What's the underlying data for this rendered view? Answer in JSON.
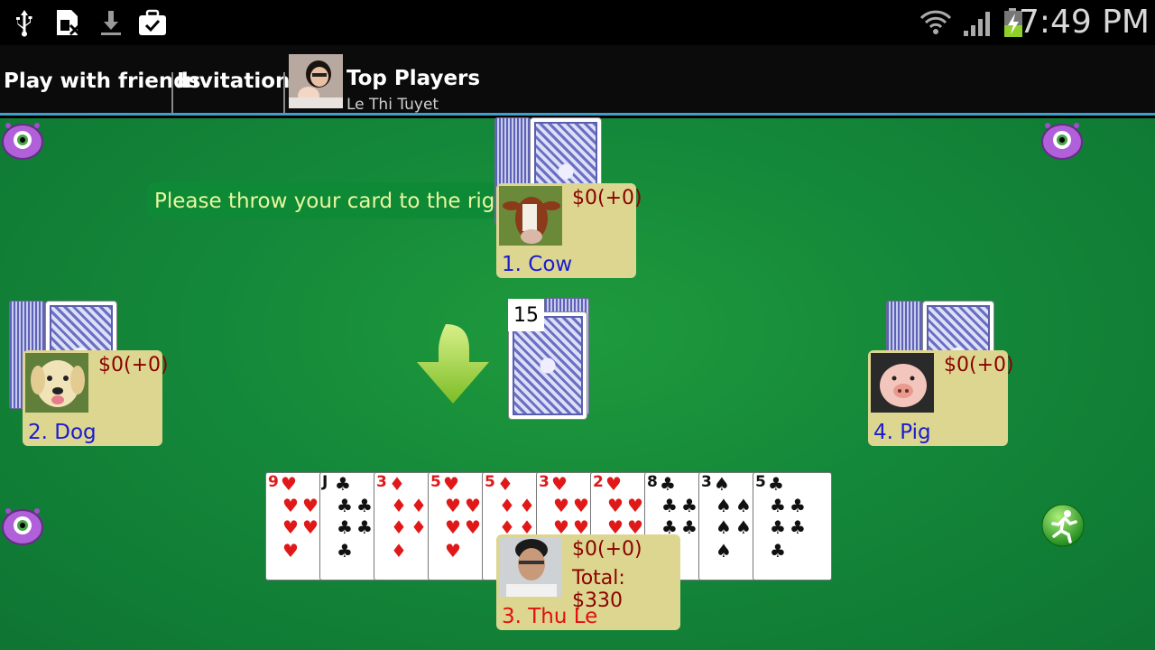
{
  "status": {
    "clock": "7:49 PM",
    "left_icons": [
      "usb-icon",
      "sim-icon",
      "download-icon",
      "briefcase-check-icon"
    ],
    "right_icons": [
      "wifi-icon",
      "signal-icon",
      "battery-charging-icon"
    ]
  },
  "tabs": {
    "play_with_friends": "Play with friends",
    "invitations": "Invitations",
    "top_players": "Top Players",
    "top_player_name": "Le Thi Tuyet"
  },
  "game": {
    "hint": "Please throw your card to the right",
    "deck_count": "15",
    "players": {
      "top": {
        "name": "1. Cow",
        "money": "$0(+0)"
      },
      "left": {
        "name": "2. Dog",
        "money": "$0(+0)"
      },
      "right": {
        "name": "4. Pig",
        "money": "$0(+0)"
      },
      "me": {
        "name": "3. Thu Le",
        "money": "$0(+0)",
        "total": "Total: $330"
      }
    },
    "hand": [
      {
        "rank": "9",
        "suit": "♥",
        "color": "red"
      },
      {
        "rank": "J",
        "suit": "♣",
        "color": "blk"
      },
      {
        "rank": "3",
        "suit": "♦",
        "color": "red"
      },
      {
        "rank": "5",
        "suit": "♥",
        "color": "red"
      },
      {
        "rank": "5",
        "suit": "♦",
        "color": "red"
      },
      {
        "rank": "3",
        "suit": "♥",
        "color": "red"
      },
      {
        "rank": "2",
        "suit": "♥",
        "color": "red"
      },
      {
        "rank": "8",
        "suit": "♣",
        "color": "blk"
      },
      {
        "rank": "3",
        "suit": "♠",
        "color": "blk"
      },
      {
        "rank": "5",
        "suit": "♣",
        "color": "blk"
      }
    ],
    "colors": {
      "table": "#14883a",
      "player_box": "#dcd690",
      "money": "#8b0000",
      "name": "#1a1ad0",
      "my_name": "#e01010"
    }
  }
}
